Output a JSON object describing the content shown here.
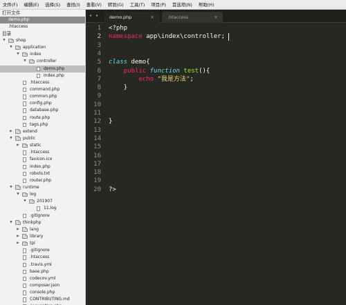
{
  "menu": [
    "文件(F)",
    "编辑(E)",
    "选择(S)",
    "查找(I)",
    "查看(V)",
    "转到(G)",
    "工具(T)",
    "项目(P)",
    "首选项(N)",
    "帮助(H)"
  ],
  "sidebar": {
    "open_files_header": "打开文件",
    "open_files": [
      "demo.php",
      ".htaccess"
    ],
    "folders_header": "目录",
    "tree": [
      {
        "label": "shop",
        "type": "folder",
        "depth": 0,
        "expanded": true
      },
      {
        "label": "application",
        "type": "folder",
        "depth": 1,
        "expanded": true
      },
      {
        "label": "index",
        "type": "folder",
        "depth": 2,
        "expanded": true
      },
      {
        "label": "controller",
        "type": "folder",
        "depth": 3,
        "expanded": true
      },
      {
        "label": "demo.php",
        "type": "file",
        "depth": 4,
        "selected": true
      },
      {
        "label": "Index.php",
        "type": "file",
        "depth": 4
      },
      {
        "label": ".htaccess",
        "type": "file",
        "depth": 2
      },
      {
        "label": "command.php",
        "type": "file",
        "depth": 2
      },
      {
        "label": "common.php",
        "type": "file",
        "depth": 2
      },
      {
        "label": "config.php",
        "type": "file",
        "depth": 2
      },
      {
        "label": "database.php",
        "type": "file",
        "depth": 2
      },
      {
        "label": "route.php",
        "type": "file",
        "depth": 2
      },
      {
        "label": "tags.php",
        "type": "file",
        "depth": 2
      },
      {
        "label": "extend",
        "type": "folder",
        "depth": 1,
        "expanded": false
      },
      {
        "label": "public",
        "type": "folder",
        "depth": 1,
        "expanded": true
      },
      {
        "label": "static",
        "type": "folder",
        "depth": 2,
        "expanded": false
      },
      {
        "label": ".htaccess",
        "type": "file",
        "depth": 2
      },
      {
        "label": "favicon.ico",
        "type": "file",
        "depth": 2
      },
      {
        "label": "index.php",
        "type": "file",
        "depth": 2
      },
      {
        "label": "robots.txt",
        "type": "file",
        "depth": 2
      },
      {
        "label": "router.php",
        "type": "file",
        "depth": 2
      },
      {
        "label": "runtime",
        "type": "folder",
        "depth": 1,
        "expanded": true
      },
      {
        "label": "log",
        "type": "folder",
        "depth": 2,
        "expanded": true
      },
      {
        "label": "201907",
        "type": "folder",
        "depth": 3,
        "expanded": true
      },
      {
        "label": "11.log",
        "type": "file",
        "depth": 4
      },
      {
        "label": ".gitignore",
        "type": "file",
        "depth": 2
      },
      {
        "label": "thinkphp",
        "type": "folder",
        "depth": 1,
        "expanded": true
      },
      {
        "label": "lang",
        "type": "folder",
        "depth": 2,
        "expanded": false
      },
      {
        "label": "library",
        "type": "folder",
        "depth": 2,
        "expanded": false
      },
      {
        "label": "tpl",
        "type": "folder",
        "depth": 2,
        "expanded": false
      },
      {
        "label": ".gitignore",
        "type": "file",
        "depth": 2
      },
      {
        "label": ".htaccess",
        "type": "file",
        "depth": 2
      },
      {
        "label": ".travis.yml",
        "type": "file",
        "depth": 2
      },
      {
        "label": "base.php",
        "type": "file",
        "depth": 2
      },
      {
        "label": "codecov.yml",
        "type": "file",
        "depth": 2
      },
      {
        "label": "composer.json",
        "type": "file",
        "depth": 2
      },
      {
        "label": "console.php",
        "type": "file",
        "depth": 2
      },
      {
        "label": "CONTRIBUTING.md",
        "type": "file",
        "depth": 2
      },
      {
        "label": "convention.php",
        "type": "file",
        "depth": 2
      }
    ]
  },
  "tabs": {
    "nav_prev": "◂",
    "nav_next": "▸",
    "items": [
      {
        "label": "demo.php",
        "active": true,
        "close": "×"
      },
      {
        "label": ".htaccess",
        "active": false,
        "close": "×"
      }
    ]
  },
  "editor": {
    "current_line": 2,
    "lines": [
      [
        {
          "t": "<?php",
          "c": "white"
        }
      ],
      [
        {
          "t": "namespace",
          "c": "pink"
        },
        {
          "t": " app\\index\\controller;",
          "c": "white"
        }
      ],
      [],
      [],
      [
        {
          "t": "class",
          "c": "blue",
          "i": true
        },
        {
          "t": " demo{",
          "c": "white"
        }
      ],
      [
        {
          "t": "    ",
          "c": "white"
        },
        {
          "t": "public",
          "c": "pink"
        },
        {
          "t": " ",
          "c": "white"
        },
        {
          "t": "function",
          "c": "blue",
          "i": true
        },
        {
          "t": " ",
          "c": "white"
        },
        {
          "t": "test",
          "c": "green"
        },
        {
          "t": "(){",
          "c": "white"
        }
      ],
      [
        {
          "t": "        ",
          "c": "white"
        },
        {
          "t": "echo",
          "c": "pink"
        },
        {
          "t": " ",
          "c": "white"
        },
        {
          "t": "\"我是方法\"",
          "c": "yellow"
        },
        {
          "t": ";",
          "c": "white"
        }
      ],
      [
        {
          "t": "    }",
          "c": "white"
        }
      ],
      [],
      [],
      [],
      [
        {
          "t": "}",
          "c": "white"
        }
      ],
      [],
      [],
      [],
      [],
      [],
      [],
      [],
      [
        {
          "t": "?>",
          "c": "white"
        }
      ]
    ]
  }
}
